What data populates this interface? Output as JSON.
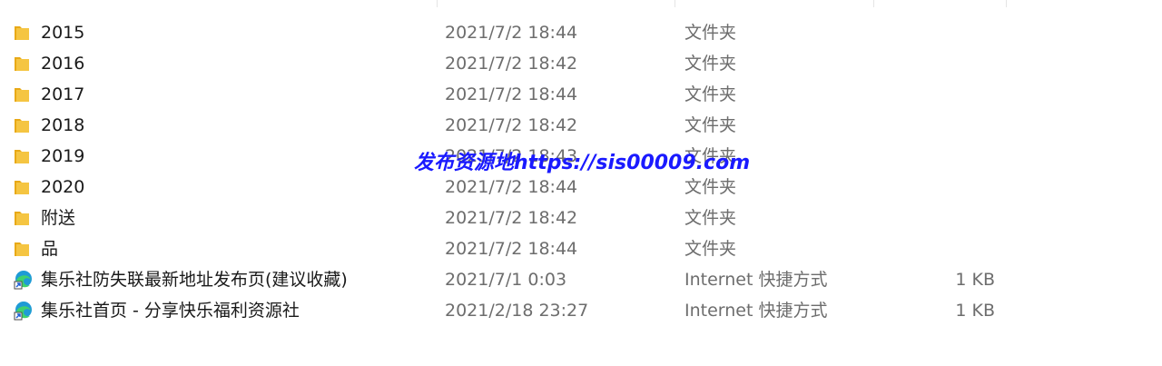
{
  "rows": [
    {
      "icon": "folder-icon",
      "name": "2015",
      "date": "2021/7/2 18:44",
      "type": "文件夹",
      "size": ""
    },
    {
      "icon": "folder-icon",
      "name": "2016",
      "date": "2021/7/2 18:42",
      "type": "文件夹",
      "size": ""
    },
    {
      "icon": "folder-icon",
      "name": "2017",
      "date": "2021/7/2 18:44",
      "type": "文件夹",
      "size": ""
    },
    {
      "icon": "folder-icon",
      "name": "2018",
      "date": "2021/7/2 18:42",
      "type": "文件夹",
      "size": ""
    },
    {
      "icon": "folder-icon",
      "name": "2019",
      "date": "2021/7/2 18:43",
      "type": "文件夹",
      "size": ""
    },
    {
      "icon": "folder-icon",
      "name": "2020",
      "date": "2021/7/2 18:44",
      "type": "文件夹",
      "size": ""
    },
    {
      "icon": "folder-icon",
      "name": "附送",
      "date": "2021/7/2 18:42",
      "type": "文件夹",
      "size": ""
    },
    {
      "icon": "folder-icon",
      "name": "品",
      "date": "2021/7/2 18:44",
      "type": "文件夹",
      "size": ""
    },
    {
      "icon": "edge-shortcut-icon",
      "name": "集乐社防失联最新地址发布页(建议收藏)",
      "date": "2021/7/1 0:03",
      "type": "Internet 快捷方式",
      "size": "1 KB"
    },
    {
      "icon": "edge-shortcut-icon",
      "name": "集乐社首页 - 分享快乐福利资源社",
      "date": "2021/2/18 23:27",
      "type": "Internet 快捷方式",
      "size": "1 KB"
    }
  ],
  "watermark": "发布资源地https://sis00009.com",
  "colors": {
    "folder": "#f5c542",
    "watermark": "#1a1aff",
    "secondary_text": "#6d6d6d",
    "primary_text": "#1a1a1a"
  }
}
